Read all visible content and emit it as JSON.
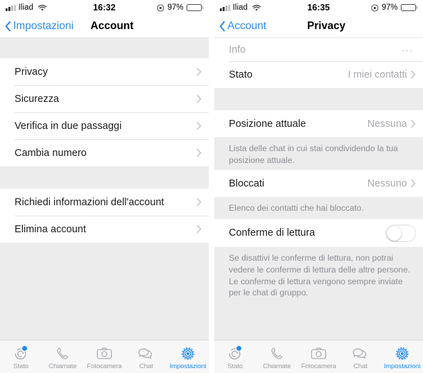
{
  "left": {
    "status_bar": {
      "carrier": "Iliad",
      "time": "16:32",
      "battery_pct": "97%",
      "signal_icon": "cellular-bars-icon",
      "wifi_icon": "wifi-icon",
      "alarm_icon": "alarm-clock-icon",
      "battery_icon": "battery-icon"
    },
    "nav": {
      "back_label": "Impostazioni",
      "back_icon": "chevron-left-icon",
      "title": "Account"
    },
    "rows_group_1": [
      {
        "label": "Privacy",
        "accessory": "chevron-right-icon"
      },
      {
        "label": "Sicurezza",
        "accessory": "chevron-right-icon"
      },
      {
        "label": "Verifica in due passaggi",
        "accessory": "chevron-right-icon"
      },
      {
        "label": "Cambia numero",
        "accessory": "chevron-right-icon"
      }
    ],
    "rows_group_2": [
      {
        "label": "Richiedi informazioni dell'account",
        "accessory": "chevron-right-icon"
      },
      {
        "label": "Elimina account",
        "accessory": "chevron-right-icon"
      }
    ]
  },
  "right": {
    "status_bar": {
      "carrier": "Iliad",
      "time": "16:35",
      "battery_pct": "97%",
      "signal_icon": "cellular-bars-icon",
      "wifi_icon": "wifi-icon",
      "alarm_icon": "alarm-clock-icon",
      "battery_icon": "battery-icon"
    },
    "nav": {
      "back_label": "Account",
      "back_icon": "chevron-left-icon",
      "title": "Privacy"
    },
    "row_info": {
      "label": "Info",
      "accessory": "ellipsis-icon",
      "accessory_text": "···"
    },
    "row_stato": {
      "label": "Stato",
      "value": "I miei contatti",
      "accessory": "chevron-right-icon"
    },
    "row_posizione": {
      "label": "Posizione attuale",
      "value": "Nessuna",
      "accessory": "chevron-right-icon"
    },
    "footnote_posizione": "Lista delle chat in cui stai condividendo la tua posizione attuale.",
    "row_bloccati": {
      "label": "Bloccati",
      "value": "Nessuno",
      "accessory": "chevron-right-icon"
    },
    "footnote_bloccati": "Elenco dei contatti che hai bloccato.",
    "row_conferme": {
      "label": "Conferme di lettura",
      "toggle_state": "off"
    },
    "footnote_conferme": "Se disattivi le conferme di lettura, non potrai vedere le conferme di lettura delle altre persone. Le conferme di lettura vengono sempre inviate per le chat di gruppo."
  },
  "tabbar": {
    "items": [
      {
        "label": "Stato",
        "icon": "status-rings-icon",
        "active": false,
        "badge": true
      },
      {
        "label": "Chiamate",
        "icon": "phone-icon",
        "active": false,
        "badge": false
      },
      {
        "label": "Fotocamera",
        "icon": "camera-icon",
        "active": false,
        "badge": false
      },
      {
        "label": "Chat",
        "icon": "chat-bubbles-icon",
        "active": false,
        "badge": false
      },
      {
        "label": "Impostazioni",
        "icon": "gear-icon",
        "active": true,
        "badge": false
      }
    ]
  },
  "colors": {
    "accent": "#1f8bf0",
    "link": "#2e8bf0",
    "group_background": "#ececed",
    "row_background": "#ffffff",
    "secondary_text": "#a9a9ae",
    "footnote_text": "#8d8d93"
  }
}
